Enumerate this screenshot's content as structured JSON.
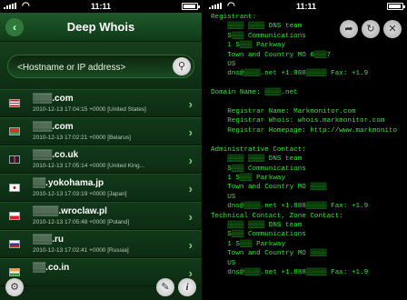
{
  "status": {
    "time": "11:11"
  },
  "nav": {
    "title": "Deep Whois",
    "back_icon": "back-arrow-icon"
  },
  "search": {
    "placeholder": "<Hostname or IP address>"
  },
  "history": [
    {
      "domain": "▒▒▒.com",
      "meta": "2010-12-13 17:04:15 +0000 [United States]"
    },
    {
      "domain": "▒▒▒.com",
      "meta": "2010-12-13 17:02:21 +0000 [Belarus]"
    },
    {
      "domain": "▒▒▒.co.uk",
      "meta": "2010-12-13 17:05:14 +0000 [United King..."
    },
    {
      "domain": "▒▒.yokohama.jp",
      "meta": "2010-12-13 17:03:19 +0000 [Japan]"
    },
    {
      "domain": "▒▒▒▒.wroclaw.pl",
      "meta": "2010-12-13 17:05:48 +0000 [Poland]"
    },
    {
      "domain": "▒▒▒.ru",
      "meta": "2010-12-13 17:02:41 +0000 [Russia]"
    },
    {
      "domain": "▒▒.co.in",
      "meta": ""
    }
  ],
  "whois_lines": [
    "Registrant:",
    "    ▒▒▒▒ ▒▒▒▒ DNS team",
    "    S▒▒▒ Communications",
    "    1 S▒▒▒ Parkway",
    "    Town and Country MO 6▒▒▒7",
    "    US",
    "    dns@▒▒▒▒.net +1.888▒▒▒▒▒ Fax: +1.9",
    "",
    "Domain Name: ▒▒▒▒.net",
    "",
    "    Registrar Name: Markmonitor.com",
    "    Registrar Whois: whois.markmonitor.com",
    "    Registrar Homepage: http://www.markmonito",
    "",
    "Administrative Contact:",
    "    ▒▒▒▒ ▒▒▒▒ DNS team",
    "    S▒▒▒ Communications",
    "    1 S▒▒▒ Parkway",
    "    Town and Country MO ▒▒▒▒",
    "    US",
    "    dns@▒▒▒▒.net +1.888▒▒▒▒▒ Fax: +1.9",
    "Technical Contact, Zone Contact:",
    "    ▒▒▒▒ ▒▒▒▒ DNS team",
    "    S▒▒▒ Communications",
    "    1 S▒▒▒ Parkway",
    "    Town and Country MO ▒▒▒▒",
    "    US",
    "    dns@▒▒▒▒.net +1.888▒▒▒▒▒ Fax: +1.9"
  ],
  "icons": {
    "search": "magnifier-icon",
    "settings": "wrench-icon",
    "info": "info-icon",
    "share": "share-arrow-icon",
    "refresh": "refresh-icon",
    "close": "close-icon"
  }
}
